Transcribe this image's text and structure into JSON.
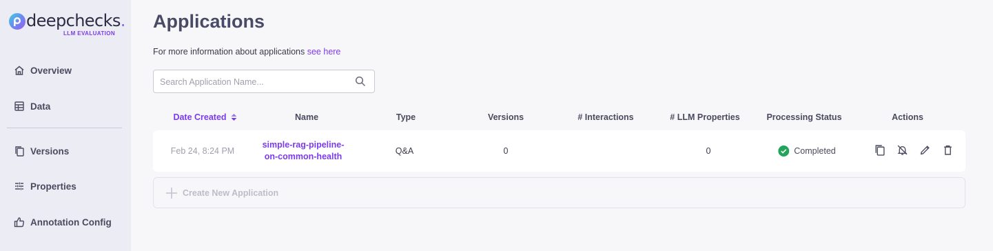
{
  "brand": {
    "name": "deepchecks",
    "dot": ".",
    "subtitle": "LLM EVALUATION",
    "accent": "#7c3aed"
  },
  "sidebar": {
    "items": [
      {
        "label": "Overview",
        "icon": "home-icon"
      },
      {
        "label": "Data",
        "icon": "table-icon"
      },
      {
        "label": "Versions",
        "icon": "copy-icon"
      },
      {
        "label": "Properties",
        "icon": "sliders-icon"
      },
      {
        "label": "Annotation Config",
        "icon": "thumbs-up-icon"
      }
    ]
  },
  "page": {
    "title": "Applications",
    "info_text": "For more information about applications ",
    "info_link": "see here"
  },
  "search": {
    "placeholder": "Search Application Name...",
    "value": ""
  },
  "table": {
    "headers": {
      "date": "Date Created",
      "name": "Name",
      "type": "Type",
      "versions": "Versions",
      "interactions": "# Interactions",
      "llm_properties": "# LLM Properties",
      "status": "Processing Status",
      "actions": "Actions"
    },
    "rows": [
      {
        "date": "Feb 24, 8:24 PM",
        "name_line1": "simple-rag-pipeline-",
        "name_line2": "on-common-health",
        "type": "Q&A",
        "versions": "0",
        "interactions": "",
        "llm_properties": "0",
        "status": "Completed",
        "status_color": "#22a55b"
      }
    ]
  },
  "create": {
    "label": "Create New Application"
  }
}
